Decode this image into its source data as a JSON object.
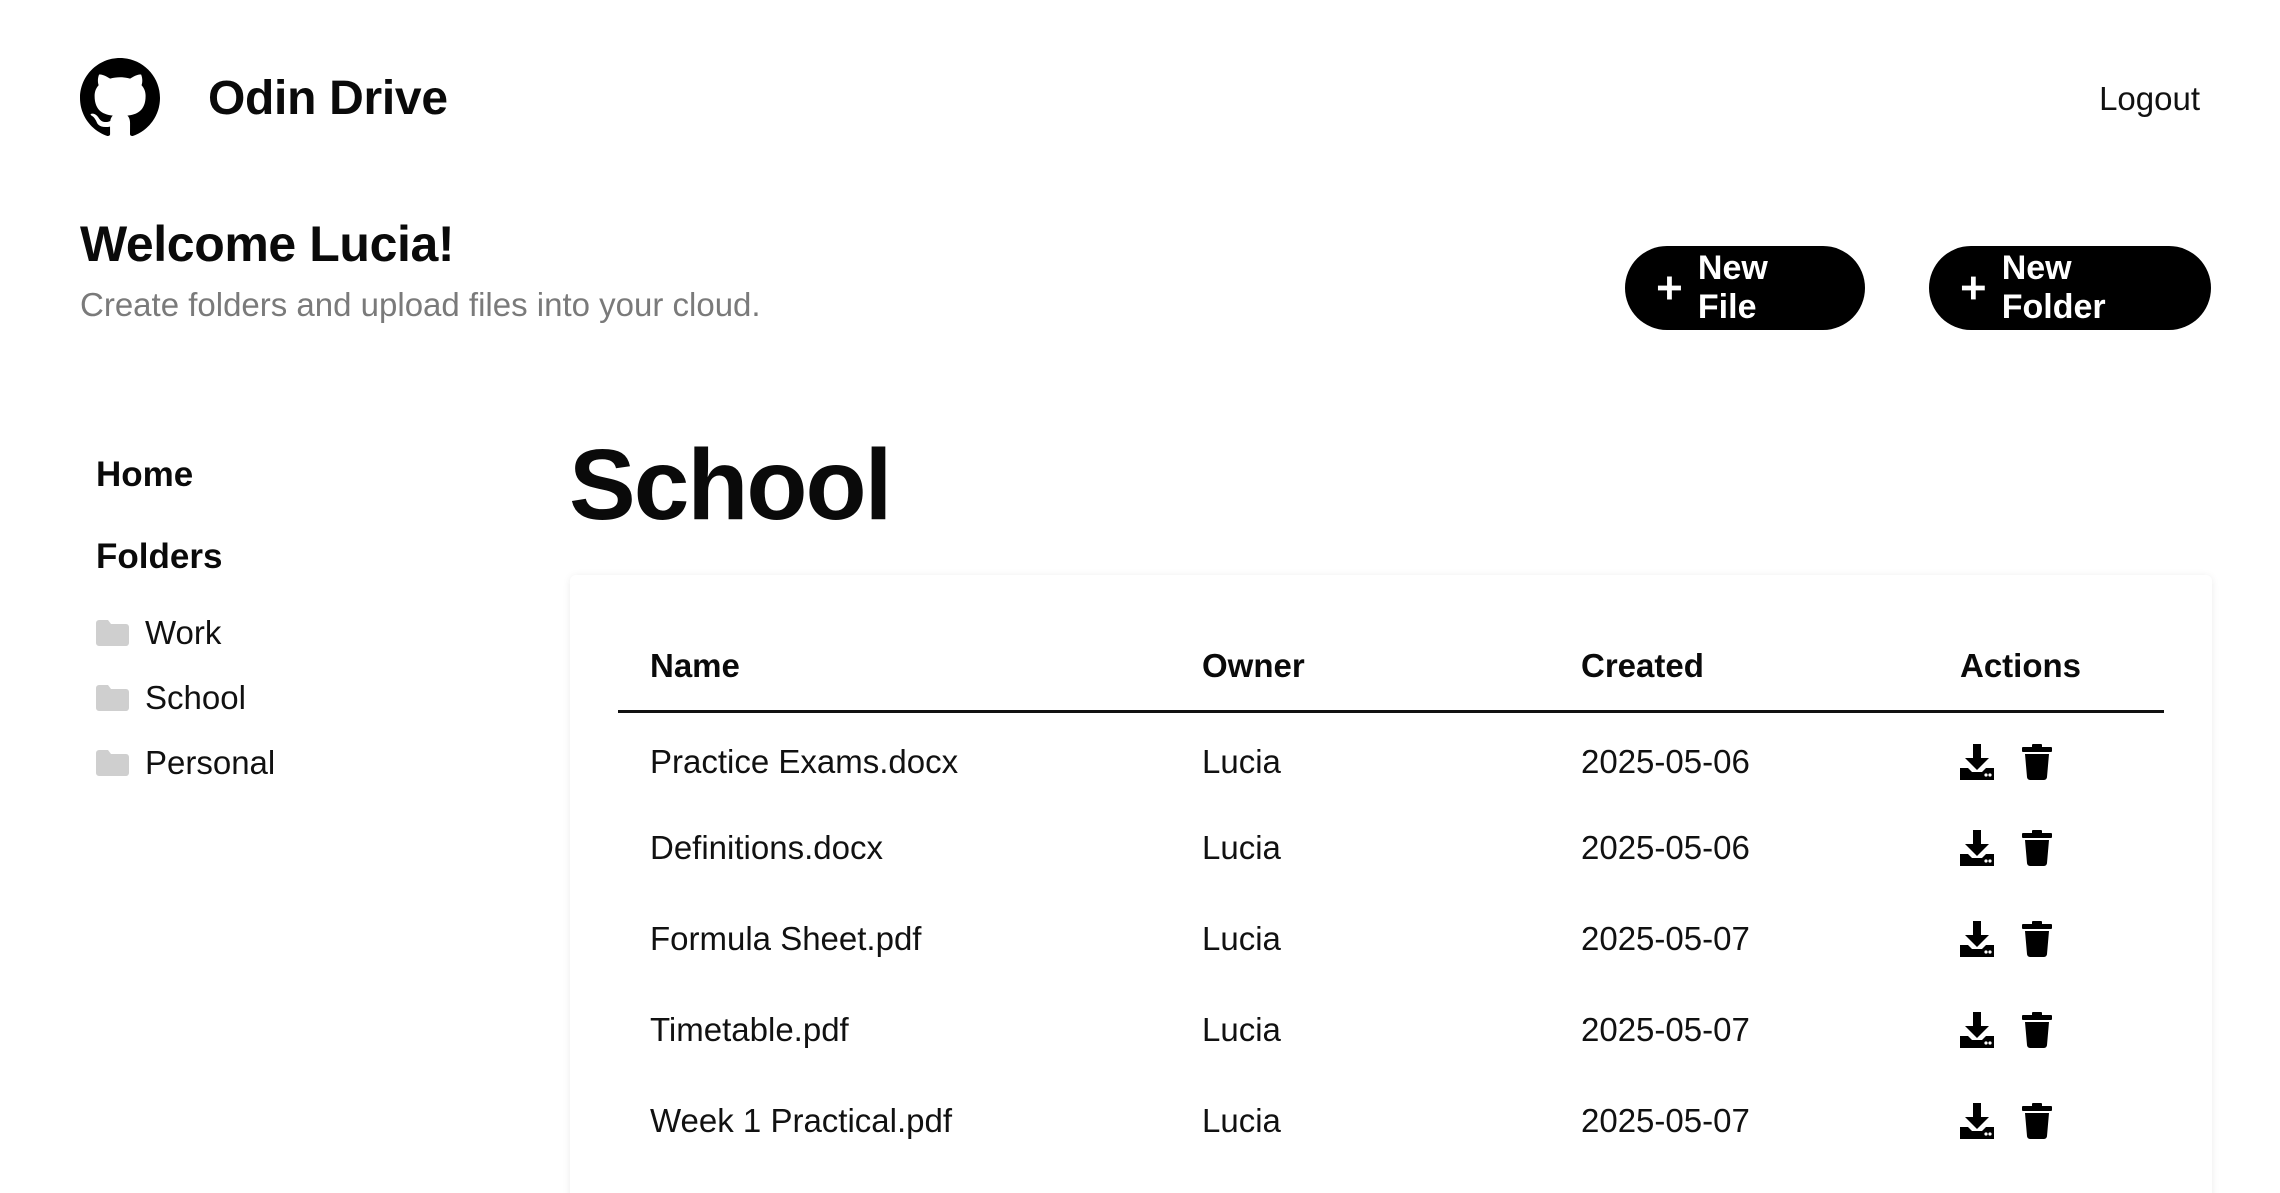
{
  "header": {
    "app_name": "Odin Drive",
    "logo_icon": "github-icon",
    "logout_label": "Logout"
  },
  "welcome": {
    "title": "Welcome Lucia!",
    "subtitle": "Create folders and upload files into your cloud."
  },
  "actions": {
    "new_file_label": "New File",
    "new_folder_label": "New Folder",
    "plus_icon": "plus-icon"
  },
  "sidebar": {
    "home_label": "Home",
    "folders_label": "Folders",
    "folder_icon": "folder-icon",
    "folders": [
      {
        "label": "Work"
      },
      {
        "label": "School"
      },
      {
        "label": "Personal"
      }
    ]
  },
  "main": {
    "title": "School",
    "table": {
      "columns": [
        "Name",
        "Owner",
        "Created",
        "Actions"
      ],
      "rows": [
        {
          "name": "Practice Exams.docx",
          "owner": "Lucia",
          "created": "2025-05-06"
        },
        {
          "name": "Definitions.docx",
          "owner": "Lucia",
          "created": "2025-05-06"
        },
        {
          "name": "Formula Sheet.pdf",
          "owner": "Lucia",
          "created": "2025-05-07"
        },
        {
          "name": "Timetable.pdf",
          "owner": "Lucia",
          "created": "2025-05-07"
        },
        {
          "name": "Week 1 Practical.pdf",
          "owner": "Lucia",
          "created": "2025-05-07"
        }
      ],
      "row_action_icons": [
        "download-icon",
        "trash-icon"
      ]
    }
  },
  "colors": {
    "primary": "#000000",
    "button_text": "#ffffff",
    "muted_text": "#7a7a7a",
    "folder_icon": "#cfcfcf"
  }
}
